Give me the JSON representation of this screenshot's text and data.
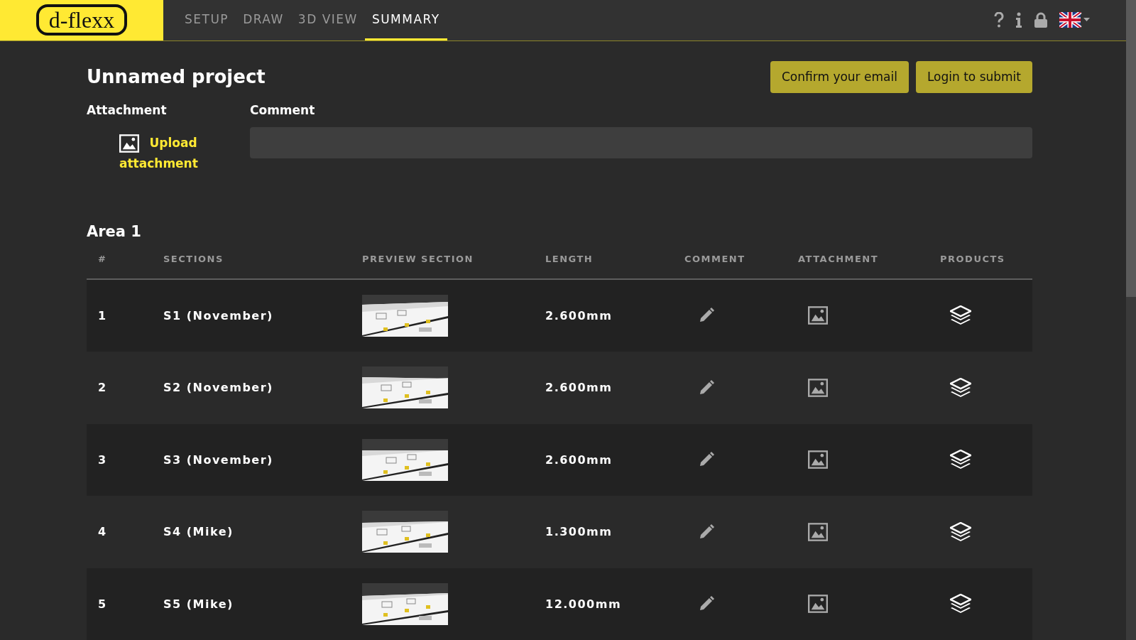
{
  "header": {
    "logo": "d-flexx",
    "tabs": [
      {
        "label": "SETUP",
        "selected": false
      },
      {
        "label": "DRAW",
        "selected": false
      },
      {
        "label": "3D VIEW",
        "selected": false
      },
      {
        "label": "SUMMARY",
        "selected": true
      }
    ]
  },
  "project": {
    "title": "Unnamed project",
    "buttons": [
      "Confirm your email",
      "Login to submit"
    ],
    "attachment_label": "Attachment",
    "upload_link": "Upload attachment",
    "comment_label": "Comment"
  },
  "area": {
    "title": "Area 1",
    "columns": [
      "#",
      "SECTIONS",
      "PREVIEW SECTION",
      "LENGTH",
      "COMMENT",
      "ATTACHMENT",
      "PRODUCTS"
    ],
    "rows": [
      {
        "number": "1",
        "section": "S1 (November)",
        "length": "2.600mm"
      },
      {
        "number": "2",
        "section": "S2 (November)",
        "length": "2.600mm"
      },
      {
        "number": "3",
        "section": "S3 (November)",
        "length": "2.600mm"
      },
      {
        "number": "4",
        "section": "S4 (Mike)",
        "length": "1.300mm"
      },
      {
        "number": "5",
        "section": "S5 (Mike)",
        "length": "12.000mm"
      }
    ]
  }
}
